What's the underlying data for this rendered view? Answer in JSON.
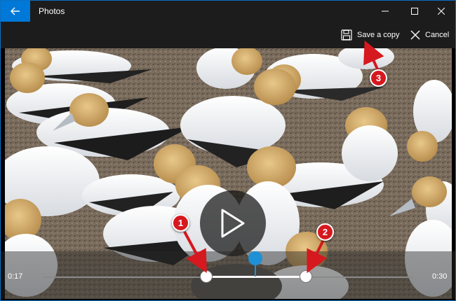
{
  "window": {
    "title": "Photos",
    "accent_color": "#0078d7"
  },
  "toolbar": {
    "save_label": "Save a copy",
    "cancel_label": "Cancel"
  },
  "player": {
    "start_time": "0:17",
    "end_time": "0:30"
  },
  "callouts": [
    "1",
    "2",
    "3"
  ],
  "icons": {
    "back": "arrow-left-icon",
    "minimize": "minimize-icon",
    "maximize": "maximize-icon",
    "close": "close-icon",
    "save": "floppy-disk-icon",
    "cancel": "x-icon",
    "play": "play-icon"
  }
}
